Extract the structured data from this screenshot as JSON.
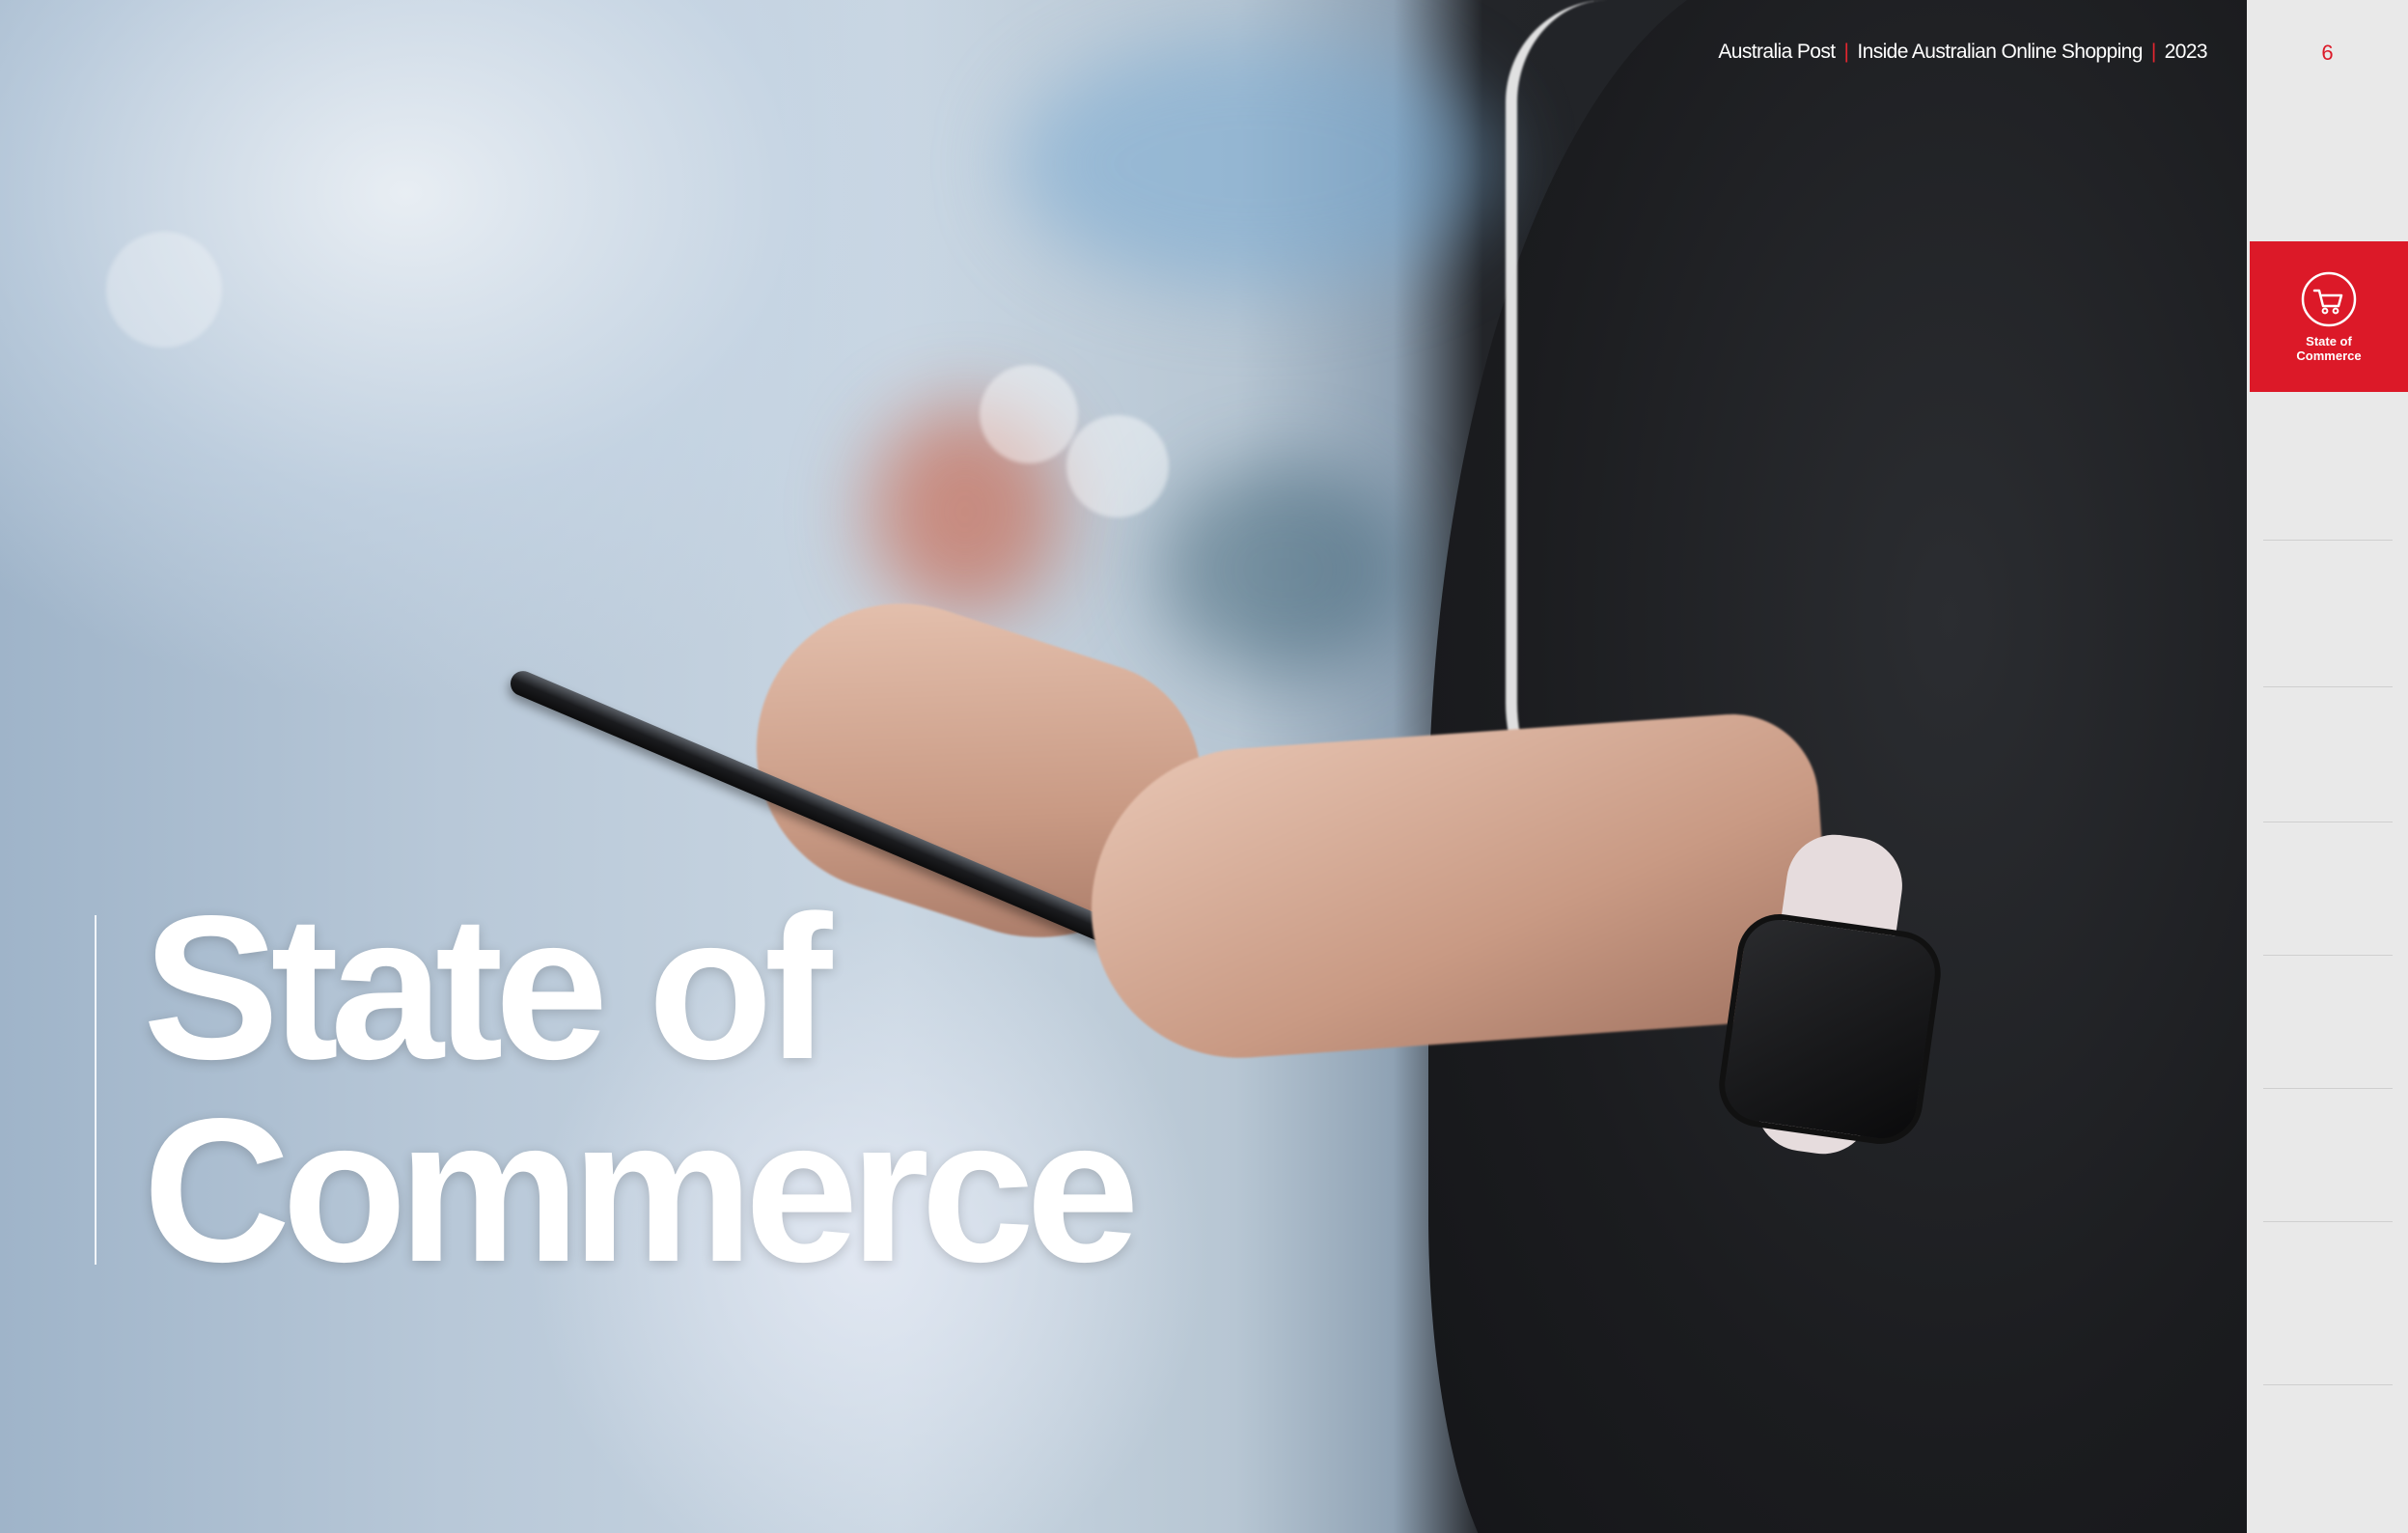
{
  "header": {
    "publisher": "Australia Post",
    "report": "Inside Australian Online Shopping",
    "year": "2023",
    "separator": "|"
  },
  "page_number": "6",
  "title": {
    "line1": "State of",
    "line2": "Commerce"
  },
  "sidebar": {
    "active_item": {
      "icon": "shopping-cart-icon",
      "label_line1": "State of",
      "label_line2": "Commerce"
    }
  },
  "colors": {
    "accent_red": "#dc1928",
    "sidebar_bg": "#e9e9e9",
    "title_text": "#ffffff"
  }
}
